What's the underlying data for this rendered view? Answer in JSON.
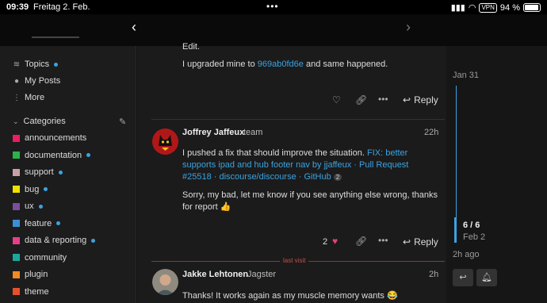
{
  "statusbar": {
    "time": "09:39",
    "date": "Freitag 2. Feb.",
    "vpn": "VPN",
    "battery": "94 %"
  },
  "sidebar": {
    "top_items": [
      {
        "label": "Topics",
        "icon": "layers-icon",
        "dot": true
      },
      {
        "label": "My Posts",
        "icon": "user-icon",
        "dot": false
      },
      {
        "label": "More",
        "icon": "vertical-ellipsis-icon",
        "dot": false
      }
    ],
    "categories_label": "Categories",
    "categories": [
      {
        "label": "announcements",
        "color": "#e91e63",
        "dot": false
      },
      {
        "label": "documentation",
        "color": "#2ab34a",
        "dot": true
      },
      {
        "label": "support",
        "color": "#c9a0a8",
        "dot": true
      },
      {
        "label": "bug",
        "color": "#f0e000",
        "dot": true
      },
      {
        "label": "ux",
        "color": "#7a4e9c",
        "dot": true
      },
      {
        "label": "feature",
        "color": "#3b8fd6",
        "dot": true
      },
      {
        "label": "data & reporting",
        "color": "#e83e8c",
        "dot": true
      },
      {
        "label": "community",
        "color": "#1aa89c",
        "dot": false
      },
      {
        "label": "plugin",
        "color": "#f08a24",
        "dot": false
      },
      {
        "label": "theme",
        "color": "#e6502c",
        "dot": false
      }
    ]
  },
  "posts": {
    "p1": {
      "edit_text": "Edit.",
      "text_before": "I upgraded mine to ",
      "commit_link": "969ab0fd6e",
      "text_after": " and same happened.",
      "reply_label": "Reply"
    },
    "p2": {
      "username": "Joffrey Jaffeux",
      "title": "team",
      "time": "22h",
      "para1_text": "I pushed a fix that should improve the situation. ",
      "pr_link": "FIX: better supports ipad and hub footer nav by jjaffeux · Pull Request #25518 · discourse/discourse · GitHub",
      "pr_badge": "2",
      "para2": "Sorry, my bad, let me know if you see anything else wrong, thanks for report",
      "emoji": "👍",
      "like_count": "2",
      "reply_label": "Reply"
    },
    "last_visit": "last visit",
    "p3": {
      "username": "Jakke Lehtonen",
      "title": "Jagster",
      "time": "2h",
      "text": "Thanks! It works again as my muscle memory wants",
      "emoji": "😂"
    }
  },
  "timeline": {
    "start_date": "Jan 31",
    "position": "6 / 6",
    "current_date": "Feb 2",
    "ago": "2h ago"
  }
}
